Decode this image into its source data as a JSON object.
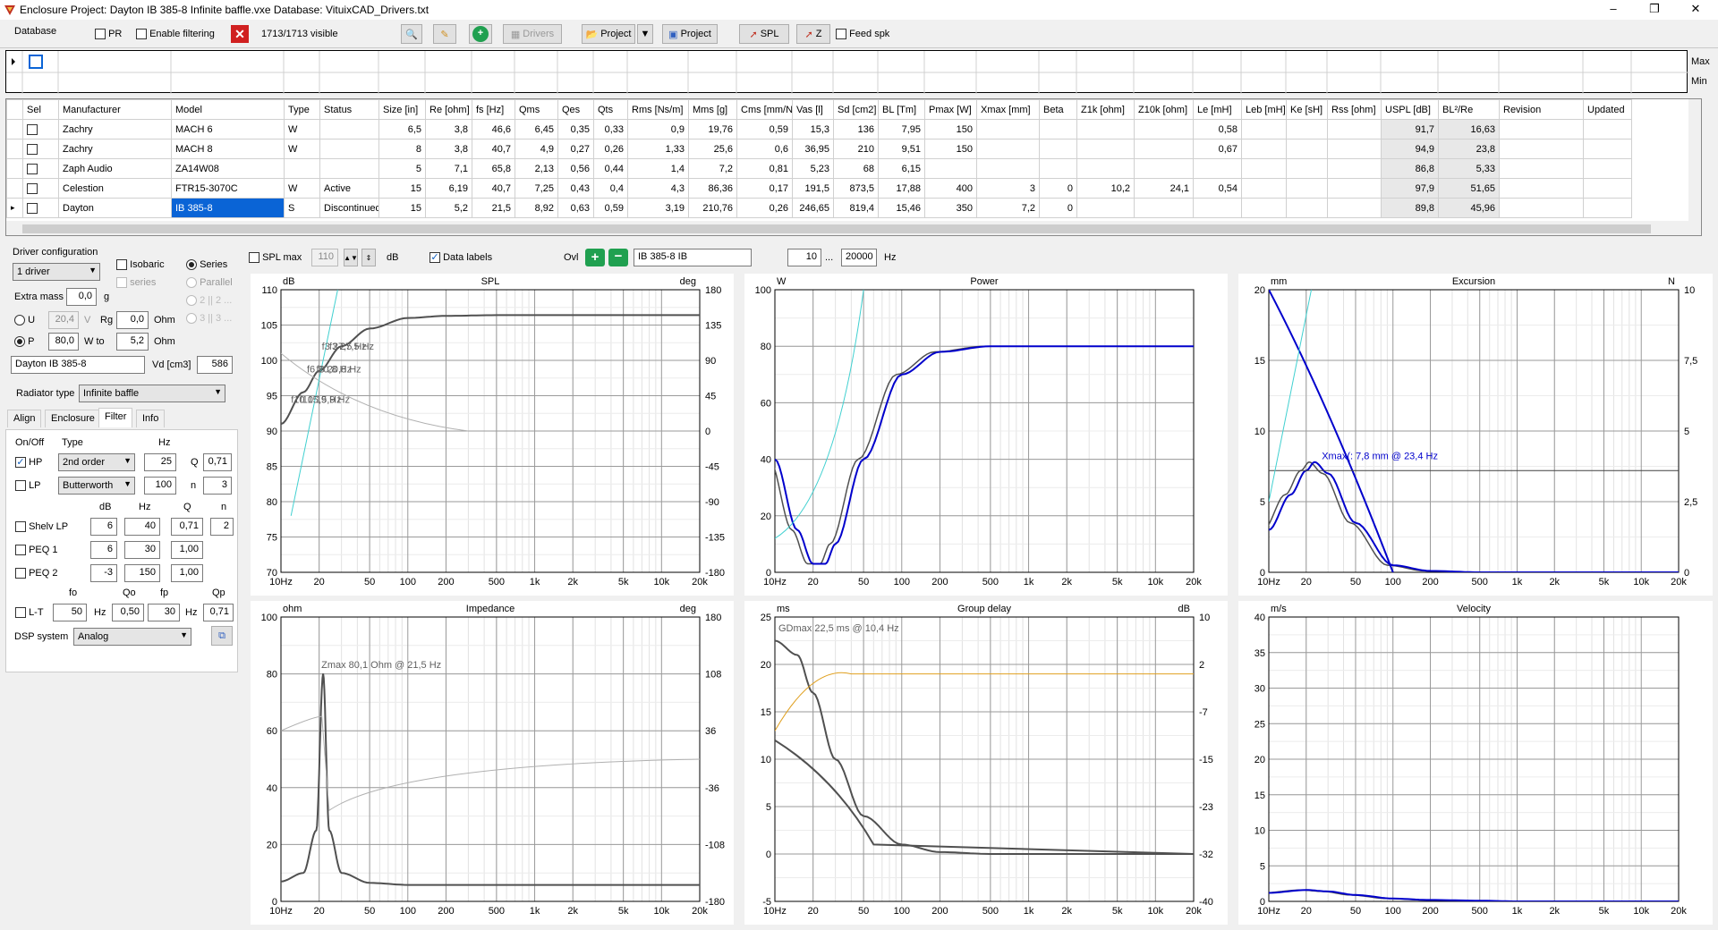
{
  "window": {
    "title": "Enclosure Project: Dayton  IB 385-8 Infinite baffle.vxe  Database: VituixCAD_Drivers.txt",
    "min": "–",
    "max": "❐",
    "close": "✕"
  },
  "toolbar": {
    "database_label": "Database",
    "pr_label": "PR",
    "enable_filtering_label": "Enable filtering",
    "visible_count": "1713/1713 visible",
    "drivers_label": "Drivers",
    "project_label": "Project",
    "project2_label": "Project",
    "spl_label": "SPL",
    "z_label": "Z",
    "feed_spk_label": "Feed spk"
  },
  "filter_row": {
    "max_label": "Max",
    "min_label": "Min"
  },
  "table": {
    "columns": [
      "Sel",
      "Manufacturer",
      "Model",
      "Type",
      "Status",
      "Size [in]",
      "Re [ohm]",
      "fs [Hz]",
      "Qms",
      "Qes",
      "Qts",
      "Rms [Ns/m]",
      "Mms [g]",
      "Cms [mm/N]",
      "Vas [l]",
      "Sd [cm2]",
      "BL [Tm]",
      "Pmax [W]",
      "Xmax [mm]",
      "Beta",
      "Z1k [ohm]",
      "Z10k [ohm]",
      "Le [mH]",
      "Leb [mH]",
      "Ke [sH]",
      "Rss [ohm]",
      "USPL [dB]",
      "BL²/Re",
      "Revision",
      "Updated"
    ],
    "rows": [
      [
        "",
        "Zachry",
        "MACH 6",
        "W",
        "",
        "6,5",
        "3,8",
        "46,6",
        "6,45",
        "0,35",
        "0,33",
        "0,9",
        "19,76",
        "0,59",
        "15,3",
        "136",
        "7,95",
        "150",
        "",
        "",
        "",
        "",
        "0,58",
        "",
        "",
        "",
        "91,7",
        "16,63",
        "",
        ""
      ],
      [
        "",
        "Zachry",
        "MACH 8",
        "W",
        "",
        "8",
        "3,8",
        "40,7",
        "4,9",
        "0,27",
        "0,26",
        "1,33",
        "25,6",
        "0,6",
        "36,95",
        "210",
        "9,51",
        "150",
        "",
        "",
        "",
        "",
        "0,67",
        "",
        "",
        "",
        "94,9",
        "23,8",
        "",
        ""
      ],
      [
        "",
        "Zaph Audio",
        "ZA14W08",
        "",
        "",
        "5",
        "7,1",
        "65,8",
        "2,13",
        "0,56",
        "0,44",
        "1,4",
        "7,2",
        "0,81",
        "5,23",
        "68",
        "6,15",
        "",
        "",
        "",
        "",
        "",
        "",
        "",
        "",
        "",
        "86,8",
        "5,33",
        "",
        ""
      ],
      [
        "",
        "Celestion",
        "FTR15-3070C",
        "W",
        "Active",
        "15",
        "6,19",
        "40,7",
        "7,25",
        "0,43",
        "0,4",
        "4,3",
        "86,36",
        "0,17",
        "191,5",
        "873,5",
        "17,88",
        "400",
        "3",
        "0",
        "10,2",
        "24,1",
        "0,54",
        "",
        "",
        "",
        "97,9",
        "51,65",
        "",
        ""
      ],
      [
        "",
        "Dayton",
        "IB 385-8",
        "S",
        "Discontinued",
        "15",
        "5,2",
        "21,5",
        "8,92",
        "0,63",
        "0,59",
        "3,19",
        "210,76",
        "0,26",
        "246,65",
        "819,4",
        "15,46",
        "350",
        "7,2",
        "0",
        "",
        "",
        "",
        "",
        "",
        "",
        "89,8",
        "45,96",
        "",
        ""
      ]
    ]
  },
  "left_panel": {
    "driver_config_label": "Driver configuration",
    "driver_count": "1 driver",
    "isobaric_label": "Isobaric",
    "series_label": "Series",
    "series2_label": "series",
    "parallel_label": "Parallel",
    "opt_22": "2 || 2 ...",
    "opt_33": "3 || 3 ...",
    "extra_mass_label": "Extra mass",
    "extra_mass_value": "0,0",
    "extra_mass_unit": "g",
    "u_label": "U",
    "u_value": "20,4",
    "v_label": "V",
    "rg_label": "Rg",
    "rg_value": "0,0",
    "ohm1": "Ohm",
    "p_label": "P",
    "p_value": "80,0",
    "wto_label": "W to",
    "wto_value": "5,2",
    "ohm2": "Ohm",
    "driver_name": "Dayton IB 385-8",
    "vd_label": "Vd [cm3]",
    "vd_value": "586",
    "radiator_label": "Radiator type",
    "radiator_value": "Infinite baffle",
    "tabs": [
      "Align",
      "Enclosure",
      "Filter",
      "Info"
    ],
    "filter_hdr": {
      "onoff": "On/Off",
      "type": "Type",
      "hz": "Hz",
      "db": "dB",
      "hz2": "Hz",
      "q": "Q",
      "n": "n"
    },
    "hp": {
      "label": "HP",
      "type": "2nd order",
      "hz": "25",
      "q_label": "Q",
      "q": "0,71"
    },
    "lp": {
      "label": "LP",
      "type": "Butterworth",
      "hz": "100",
      "n_label": "n",
      "n": "3"
    },
    "shelv": {
      "label": "Shelv LP",
      "db": "6",
      "hz": "40",
      "q": "0,71",
      "n": "2"
    },
    "peq1": {
      "label": "PEQ 1",
      "db": "6",
      "hz": "30",
      "q": "1,00"
    },
    "peq2": {
      "label": "PEQ 2",
      "db": "-3",
      "hz": "150",
      "q": "1,00"
    },
    "lt_hdr": {
      "fo": "fo",
      "qo": "Qo",
      "fp": "fp",
      "qp": "Qp"
    },
    "lt": {
      "label": "L-T",
      "fo": "50",
      "hz1": "Hz",
      "qo": "0,50",
      "fp": "30",
      "hz2": "Hz",
      "qp": "0,71"
    },
    "dsp_label": "DSP system",
    "dsp_value": "Analog"
  },
  "graph_toolbar": {
    "spl_max_label": "SPL max",
    "spl_max_value": "110",
    "db_label": "dB",
    "data_labels_label": "Data labels",
    "ovl_label": "Ovl",
    "ovl_name": "IB 385-8 IB",
    "f_from": "10",
    "f_sep": "...",
    "f_to": "20000",
    "hz_label": "Hz"
  },
  "colors": {
    "blue": "#0000cc",
    "gray": "#505050",
    "cyan": "#40d0d0",
    "orange": "#e0a020",
    "light": "#b0b0b0"
  },
  "chart_data": [
    {
      "type": "line",
      "title": "SPL",
      "yunit": "dB",
      "y2unit": "deg",
      "ylim": [
        70,
        110
      ],
      "yticks": [
        "110",
        "105",
        "100",
        "95",
        "90",
        "85",
        "80",
        "75",
        "70"
      ],
      "y2ticks": [
        "180",
        "135",
        "90",
        "45",
        "0",
        "-45",
        "-90",
        "-135",
        "-180"
      ],
      "xticks": [
        "10Hz",
        "20",
        "50",
        "100",
        "200",
        "500",
        "1k",
        "2k",
        "5k",
        "10k",
        "20k"
      ],
      "annotations": [
        "f3 27,5 Hz",
        "f6 20,8 Hz",
        "f10 15,9 Hz",
        "f3 27,5 Hz",
        "f6 20,8 Hz",
        "f10 15,9 Hz"
      ],
      "series": [
        {
          "x": [
            10,
            15,
            20,
            30,
            50,
            100,
            200,
            500,
            1000,
            20000
          ],
          "y": [
            91,
            95.5,
            98.5,
            102,
            104.5,
            106,
            106.3,
            106.4,
            106.4,
            106.4
          ]
        }
      ]
    },
    {
      "type": "line",
      "title": "Power",
      "yunit": "W",
      "ylim": [
        0,
        100
      ],
      "yticks": [
        "100",
        "80",
        "60",
        "40",
        "20",
        "0"
      ],
      "xticks": [
        "10Hz",
        "20",
        "50",
        "100",
        "200",
        "500",
        "1k",
        "2k",
        "5k",
        "10k",
        "20k"
      ],
      "series": [
        {
          "x": [
            10,
            15,
            20,
            25,
            30,
            50,
            100,
            200,
            500,
            1000,
            20000
          ],
          "y": [
            40,
            15,
            3,
            3,
            10,
            40,
            70,
            78,
            80,
            80,
            80
          ]
        }
      ]
    },
    {
      "type": "line",
      "title": "Excursion",
      "yunit": "mm",
      "y2unit": "N",
      "ylim": [
        0,
        20
      ],
      "yticks": [
        "20",
        "15",
        "10",
        "5",
        "0"
      ],
      "y2ticks": [
        "10",
        "7,5",
        "5",
        "2,5",
        "0"
      ],
      "xticks": [
        "10Hz",
        "20",
        "50",
        "100",
        "200",
        "500",
        "1k",
        "2k",
        "5k",
        "10k",
        "20k"
      ],
      "annotations": [
        "Xmax(: 7,8 mm  @ 23,4 Hz"
      ],
      "series": [
        {
          "x": [
            10,
            15,
            20,
            23.4,
            30,
            50,
            100,
            200,
            500,
            1000,
            20000
          ],
          "y": [
            3,
            5.5,
            7.2,
            7.8,
            7,
            3.5,
            0.5,
            0.1,
            0,
            0,
            0
          ]
        }
      ]
    },
    {
      "type": "line",
      "title": "Impedance",
      "yunit": "ohm",
      "y2unit": "deg",
      "ylim": [
        0,
        100
      ],
      "yticks": [
        "100",
        "80",
        "60",
        "40",
        "20",
        "0"
      ],
      "y2ticks": [
        "180",
        "108",
        "36",
        "-36",
        "-108",
        "-180"
      ],
      "xticks": [
        "10Hz",
        "20",
        "50",
        "100",
        "200",
        "500",
        "1k",
        "2k",
        "5k",
        "10k",
        "20k"
      ],
      "annotations": [
        "Zmax 80,1 Ohm @ 21,5 Hz"
      ],
      "series": [
        {
          "x": [
            10,
            15,
            19,
            21.5,
            24,
            30,
            50,
            100,
            500,
            20000
          ],
          "y": [
            7,
            10,
            25,
            80.1,
            25,
            10,
            6.5,
            5.8,
            5.8,
            5.8
          ]
        }
      ]
    },
    {
      "type": "line",
      "title": "Group delay",
      "yunit": "ms",
      "y2unit": "dB",
      "ylim": [
        -5,
        25
      ],
      "yticks": [
        "25",
        "20",
        "15",
        "10",
        "5",
        "0",
        "-5"
      ],
      "y2ticks": [
        "10",
        "2",
        "-7",
        "-15",
        "-23",
        "-32",
        "-40"
      ],
      "xticks": [
        "10Hz",
        "20",
        "50",
        "100",
        "200",
        "500",
        "1k",
        "2k",
        "5k",
        "10k",
        "20k"
      ],
      "annotations": [
        "GDmax 22,5 ms  @ 10,4 Hz"
      ],
      "series": [
        {
          "x": [
            10,
            15,
            20,
            30,
            50,
            100,
            200,
            500,
            20000
          ],
          "y": [
            22.5,
            21,
            17,
            10,
            4,
            1,
            0.2,
            0,
            0
          ]
        }
      ]
    },
    {
      "type": "line",
      "title": "Velocity",
      "yunit": "m/s",
      "ylim": [
        0,
        40
      ],
      "yticks": [
        "40",
        "35",
        "30",
        "25",
        "20",
        "15",
        "10",
        "5",
        "0"
      ],
      "xticks": [
        "10Hz",
        "20",
        "50",
        "100",
        "200",
        "500",
        "1k",
        "2k",
        "5k",
        "10k",
        "20k"
      ],
      "series": [
        {
          "x": [
            10,
            20,
            30,
            50,
            100,
            200,
            500,
            1000,
            20000
          ],
          "y": [
            1.2,
            1.6,
            1.4,
            0.9,
            0.4,
            0.2,
            0.1,
            0,
            0
          ]
        }
      ]
    }
  ]
}
